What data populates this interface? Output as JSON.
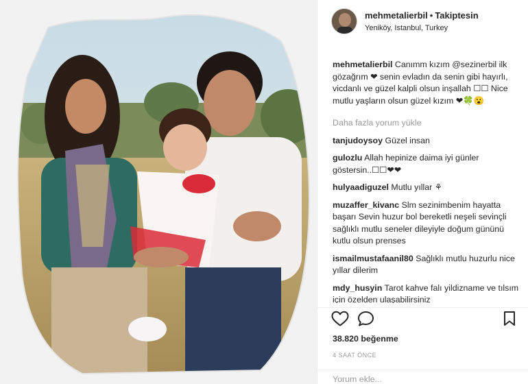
{
  "post": {
    "username": "mehmetalierbil",
    "separator": "•",
    "follow_status": "Takiptesin",
    "location": "Yeniköy, Istanbul, Turkey"
  },
  "caption": {
    "username": "mehmetalierbil",
    "text": "Canımm kızım @sezinerbil ilk gözağrım ❤ senin evladın da senin gibi hayırlı, vicdanlı ve güzel kalpli olsun inşallah ☐☐ Nice mutlu yaşların olsun güzel kızım ❤🍀😮"
  },
  "load_more_label": "Daha fazla yorum yükle",
  "comments": [
    {
      "username": "tanjudoysoy",
      "text": "Güzel insan"
    },
    {
      "username": "gulozlu",
      "text": "Allah hepinize daima iyi günler göstersin..☐☐❤❤"
    },
    {
      "username": "hulyaadiguzel",
      "text": "Mutlu yıllar ⚘"
    },
    {
      "username": "muzaffer_kivanc",
      "text": "Slm sezinimbenim hayatta başarı Sevin huzur bol bereketli neşeli sevinçli sağlıklı mutlu seneler dileyiyle doğum gününü kutlu olsun prenses"
    },
    {
      "username": "ismailmustafaanil80",
      "text": "Sağlıklı mutlu huzurlu nice yıllar dilerim"
    },
    {
      "username": "mdy_husyin",
      "text": "Tarot kahve falı yildizname ve tılsım için özelden ulaşabilirsiniz"
    }
  ],
  "actions": {
    "like_icon": "heart-outline-icon",
    "comment_icon": "speech-bubble-icon",
    "save_icon": "bookmark-icon"
  },
  "likes_label": "38.820 beğenme",
  "timestamp": "4 SAAT ÖNCE",
  "comment_input": {
    "placeholder": "Yorum ekle..."
  }
}
